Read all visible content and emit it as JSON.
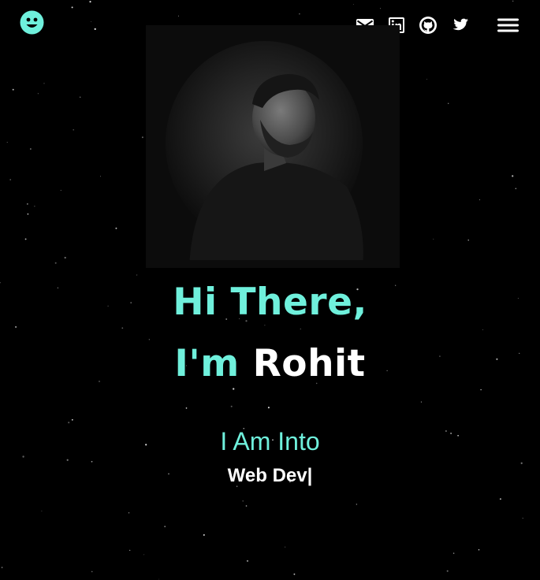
{
  "header": {
    "logo_icon": "smiley-face-icon",
    "social_links": [
      {
        "name": "email",
        "icon": "mail-icon"
      },
      {
        "name": "linkedin",
        "icon": "linkedin-icon"
      },
      {
        "name": "github",
        "icon": "github-icon"
      },
      {
        "name": "twitter",
        "icon": "twitter-icon"
      }
    ],
    "menu_icon": "hamburger-menu-icon"
  },
  "hero": {
    "greeting": "Hi There,",
    "intro_prefix": "I'm",
    "name": "Rohit",
    "subtitle": "I Am Into",
    "role": "Web Dev|"
  },
  "colors": {
    "background": "#000000",
    "accent": "#6ff0dc",
    "text": "#ffffff"
  }
}
